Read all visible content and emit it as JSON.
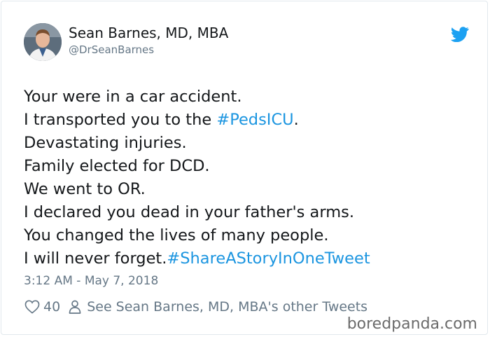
{
  "author": {
    "name": "Sean Barnes, MD, MBA",
    "handle": "@DrSeanBarnes",
    "avatar_icon": "profile-photo"
  },
  "tweet": {
    "lines": [
      [
        {
          "text": "Your were in a car accident."
        }
      ],
      [
        {
          "text": "I transported you to the "
        },
        {
          "text": "#PedsICU",
          "hashtag": true
        },
        {
          "text": "."
        }
      ],
      [
        {
          "text": "Devastating injuries."
        }
      ],
      [
        {
          "text": "Family elected for DCD."
        }
      ],
      [
        {
          "text": "We went to OR."
        }
      ],
      [
        {
          "text": "I declared you dead in your father's arms."
        }
      ],
      [
        {
          "text": "You changed the lives of many people."
        }
      ],
      [
        {
          "text": "I will never forget."
        },
        {
          "text": "#ShareAStoryInOneTweet",
          "hashtag": true
        }
      ]
    ],
    "timestamp": "3:12 AM - May 7, 2018"
  },
  "actions": {
    "like_icon": "heart-icon",
    "like_count": "40",
    "profile_icon": "person-icon",
    "other_tweets_label": "See Sean Barnes, MD, MBA's other Tweets"
  },
  "watermark": "boredpanda.com",
  "colors": {
    "hashtag": "#1b95e0",
    "twitter_blue": "#1da1f2",
    "secondary_text": "#657786",
    "border": "#e1e8ed"
  }
}
